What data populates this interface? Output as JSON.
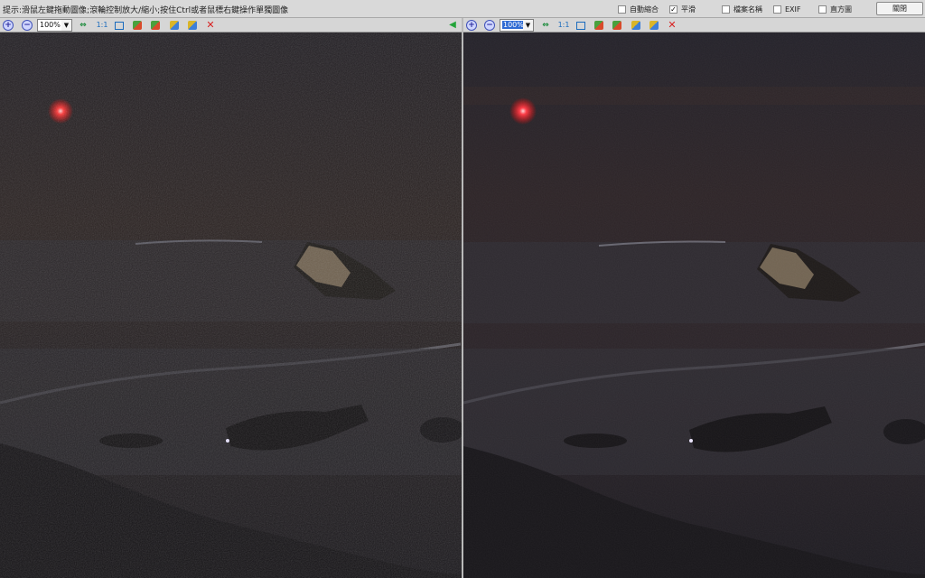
{
  "topbar": {
    "hint": "提示:滑鼠左鍵拖動圖像;滾輪控制放大/縮小;按住Ctrl或者鼠標右鍵操作單獨圖像",
    "options": [
      {
        "label": "自動縮合",
        "checked": false
      },
      {
        "label": "平滑",
        "checked": true
      },
      {
        "label": "檔案名稱",
        "checked": false
      },
      {
        "label": "EXIF",
        "checked": false
      },
      {
        "label": "直方圖",
        "checked": false
      }
    ],
    "close_label": "關閉"
  },
  "left_pane": {
    "zoom_value": "100%",
    "ratio_label": "1:1"
  },
  "right_pane": {
    "zoom_value": "100%",
    "ratio_label": "1:1"
  },
  "icons": {
    "zoom_in": "zoom-in-icon",
    "zoom_out": "zoom-out-icon",
    "fit": "fit-window-icon",
    "rotate_left": "rotate-left-icon",
    "rotate_right": "rotate-right-icon",
    "prev": "prev-image-icon",
    "next": "next-image-icon",
    "delete": "delete-icon",
    "back": "back-arrow-icon"
  },
  "colors": {
    "toolbar_bg": "#d6d6d6",
    "delete_red": "#d81f1f",
    "selection_blue": "#2f6bd4"
  }
}
